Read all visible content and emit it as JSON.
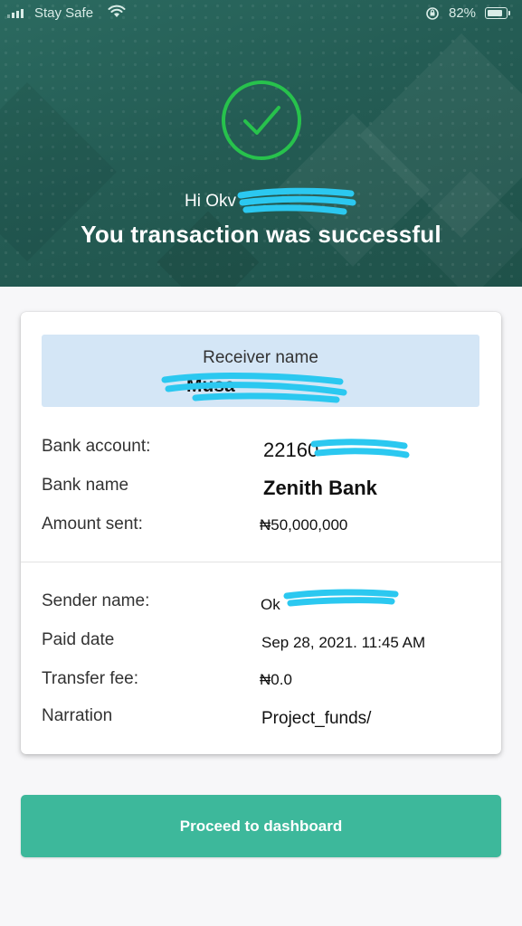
{
  "status_bar": {
    "carrier": "Stay Safe",
    "battery_percent": "82%"
  },
  "success": {
    "greeting": "Hi Okv",
    "headline": "You transaction was successful",
    "icon": "check-circle-icon",
    "icon_color": "#27c24c"
  },
  "receiver": {
    "label": "Receiver name",
    "value": "Musa"
  },
  "details_top": [
    {
      "label": "Bank account:",
      "value": "22160"
    },
    {
      "label": "Bank name",
      "value": "Zenith Bank"
    },
    {
      "label": "Amount sent:",
      "value": "₦50,000,000"
    }
  ],
  "details_bottom": [
    {
      "label": "Sender name:",
      "value": "Ok"
    },
    {
      "label": "Paid date",
      "value": "Sep 28, 2021. 11:45 AM"
    },
    {
      "label": "Transfer fee:",
      "value": "₦0.0"
    },
    {
      "label": "Narration",
      "value": "Project_funds/"
    }
  ],
  "actions": {
    "proceed_label": "Proceed to dashboard"
  },
  "colors": {
    "header_bg": "#245c54",
    "button_bg": "#3db89b",
    "receiver_bg": "#d4e6f6",
    "redaction": "#2bc8f0"
  }
}
